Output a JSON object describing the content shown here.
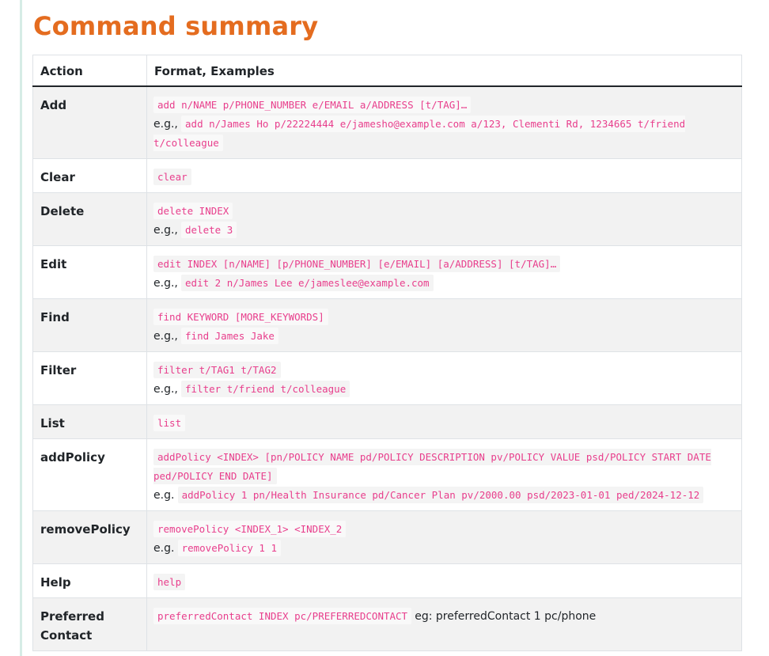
{
  "title": "Command summary",
  "table": {
    "headers": [
      "Action",
      "Format, Examples"
    ],
    "rows": [
      {
        "action": "Add",
        "format": "add n/NAME p/PHONE_NUMBER e/EMAIL a/ADDRESS [t/TAG]…",
        "eg_prefix": "e.g.,",
        "example": "add n/James Ho p/22224444 e/jamesho@example.com a/123, Clementi Rd, 1234665 t/friend t/colleague"
      },
      {
        "action": "Clear",
        "format": "clear"
      },
      {
        "action": "Delete",
        "format": "delete INDEX",
        "eg_prefix": "e.g.,",
        "example": "delete 3"
      },
      {
        "action": "Edit",
        "format": "edit INDEX [n/NAME] [p/PHONE_NUMBER] [e/EMAIL] [a/ADDRESS] [t/TAG]…",
        "eg_prefix": "e.g.,",
        "example": "edit 2 n/James Lee e/jameslee@example.com"
      },
      {
        "action": "Find",
        "format": "find KEYWORD [MORE_KEYWORDS]",
        "eg_prefix": "e.g.,",
        "example": "find James Jake"
      },
      {
        "action": "Filter",
        "format": "filter t/TAG1 t/TAG2",
        "eg_prefix": "e.g.,",
        "example": "filter t/friend t/colleague"
      },
      {
        "action": "List",
        "format": "list"
      },
      {
        "action": "addPolicy",
        "format": "addPolicy <INDEX> [pn/POLICY NAME pd/POLICY DESCRIPTION pv/POLICY VALUE psd/POLICY START DATE ped/POLICY END DATE]",
        "eg_prefix": "e.g.",
        "example": "addPolicy 1 pn/Health Insurance pd/Cancer Plan pv/2000.00 psd/2023-01-01 ped/2024-12-12"
      },
      {
        "action": "removePolicy",
        "format": "removePolicy <INDEX_1> <INDEX_2",
        "eg_prefix": "e.g.",
        "example": "removePolicy 1 1"
      },
      {
        "action": "Help",
        "format": "help"
      },
      {
        "action": "Preferred Contact",
        "format": "preferredContact INDEX pc/PREFERREDCONTACT",
        "inline_note": "eg: preferredContact 1 pc/phone"
      }
    ]
  }
}
